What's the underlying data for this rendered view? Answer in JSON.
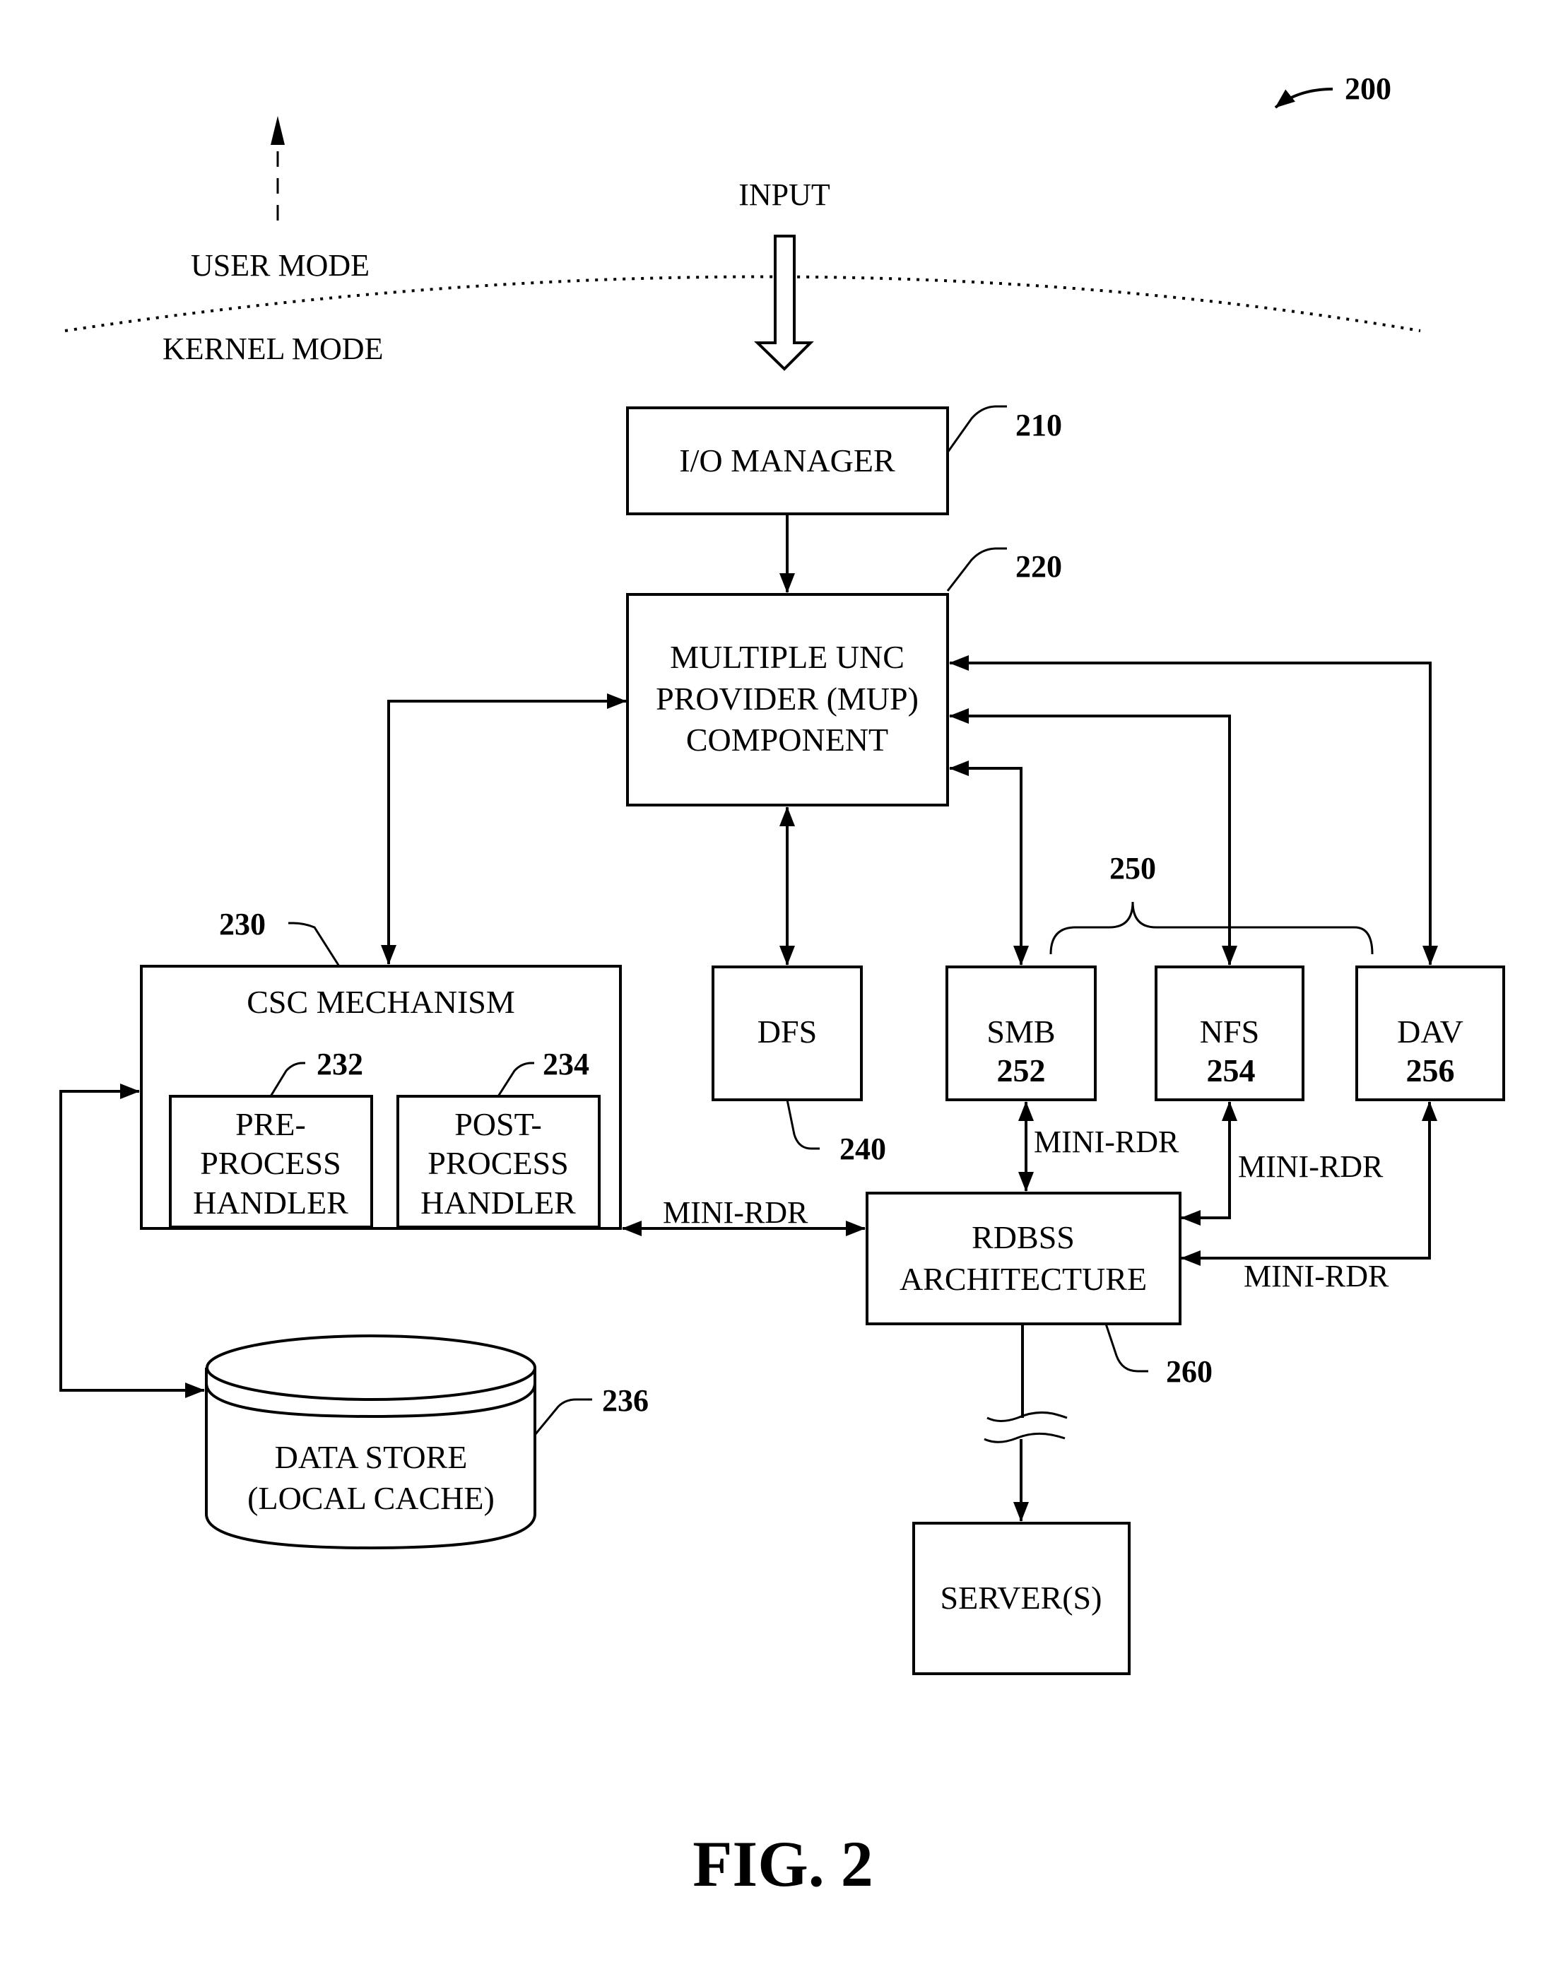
{
  "figure": {
    "ref_number": "200",
    "caption": "FIG. 2",
    "user_mode_label": "USER MODE",
    "kernel_mode_label": "KERNEL MODE",
    "input_label": "INPUT"
  },
  "nodes": {
    "io_manager": {
      "lines": [
        "I/O MANAGER"
      ],
      "ref": "210"
    },
    "mup": {
      "lines": [
        "MULTIPLE UNC",
        "PROVIDER (MUP)",
        "COMPONENT"
      ],
      "ref": "220"
    },
    "csc": {
      "lines": [
        "CSC MECHANISM"
      ],
      "ref": "230"
    },
    "pre_handler": {
      "lines": [
        "PRE-",
        "PROCESS",
        "HANDLER"
      ],
      "ref": "232"
    },
    "post_handler": {
      "lines": [
        "POST-",
        "PROCESS",
        "HANDLER"
      ],
      "ref": "234"
    },
    "data_store": {
      "lines": [
        "DATA STORE",
        "(LOCAL CACHE)"
      ],
      "ref": "236"
    },
    "dfs": {
      "lines": [
        "DFS"
      ],
      "ref": "240"
    },
    "smb": {
      "lines": [
        "SMB"
      ],
      "num": "252"
    },
    "nfs": {
      "lines": [
        "NFS"
      ],
      "num": "254"
    },
    "dav": {
      "lines": [
        "DAV"
      ],
      "num": "256"
    },
    "redirectors_group": {
      "ref": "250"
    },
    "rdbss": {
      "lines": [
        "RDBSS",
        "ARCHITECTURE"
      ],
      "ref": "260"
    },
    "servers": {
      "lines": [
        "SERVER(S)"
      ]
    }
  },
  "edges": {
    "csc_rdbss_label": "MINI-RDR",
    "smb_rdbss_label": "MINI-RDR",
    "nfs_rdbss_label": "MINI-RDR",
    "dav_rdbss_label": "MINI-RDR"
  }
}
